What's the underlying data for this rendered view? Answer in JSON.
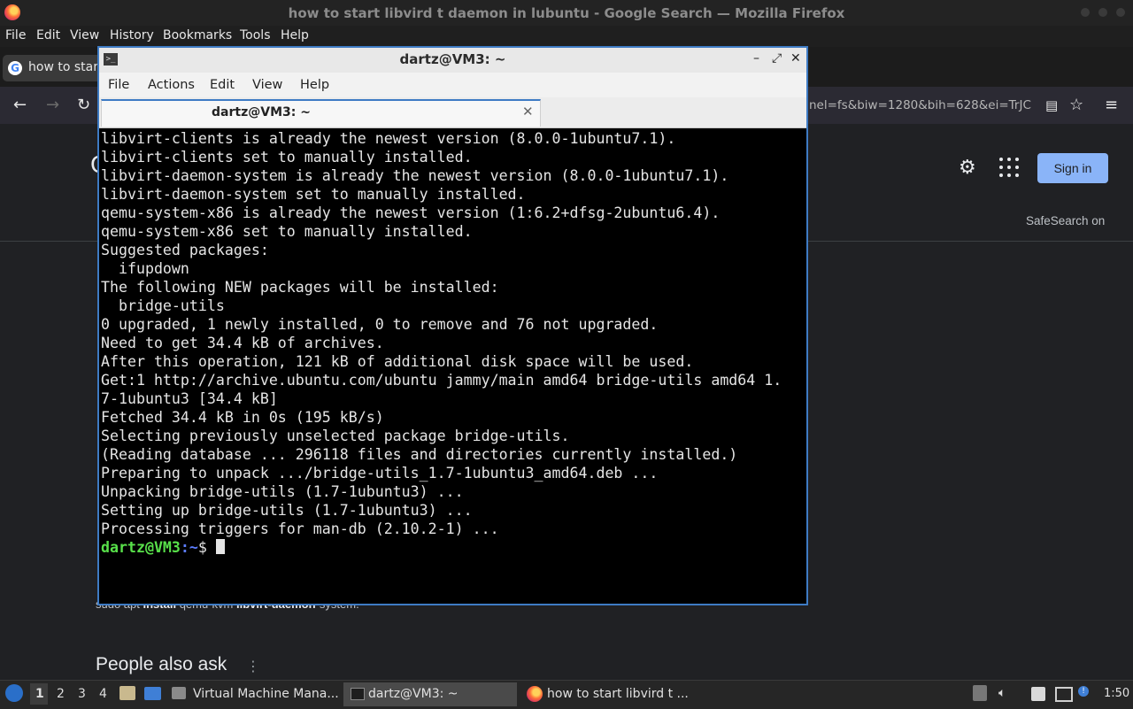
{
  "firefox": {
    "window_title": "how to start libvird t daemon in lubuntu - Google Search — Mozilla Firefox",
    "menu": [
      "File",
      "Edit",
      "View",
      "History",
      "Bookmarks",
      "Tools",
      "Help"
    ],
    "tab_label": "how to start",
    "url_tail": "nel=fs&biw=1280&bih=628&ei=TrJC",
    "google": {
      "signin": "Sign in",
      "safesearch": "SafeSearch on",
      "snippet_prefix": "sudo apt ",
      "snippet_b1": "install",
      "snippet_mid": " qemu-kvm ",
      "snippet_b2": "libvirt-daemon",
      "snippet_suffix": "-system.",
      "people_also_ask": "People also ask"
    }
  },
  "terminal": {
    "window_title": "dartz@VM3: ~",
    "menu": [
      "File",
      "Actions",
      "Edit",
      "View",
      "Help"
    ],
    "tab_label": "dartz@VM3: ~",
    "output_lines": [
      "libvirt-clients is already the newest version (8.0.0-1ubuntu7.1).",
      "libvirt-clients set to manually installed.",
      "libvirt-daemon-system is already the newest version (8.0.0-1ubuntu7.1).",
      "libvirt-daemon-system set to manually installed.",
      "qemu-system-x86 is already the newest version (1:6.2+dfsg-2ubuntu6.4).",
      "qemu-system-x86 set to manually installed.",
      "Suggested packages:",
      "  ifupdown",
      "The following NEW packages will be installed:",
      "  bridge-utils",
      "0 upgraded, 1 newly installed, 0 to remove and 76 not upgraded.",
      "Need to get 34.4 kB of archives.",
      "After this operation, 121 kB of additional disk space will be used.",
      "Get:1 http://archive.ubuntu.com/ubuntu jammy/main amd64 bridge-utils amd64 1.",
      "7-1ubuntu3 [34.4 kB]",
      "Fetched 34.4 kB in 0s (195 kB/s)",
      "Selecting previously unselected package bridge-utils.",
      "(Reading database ... 296118 files and directories currently installed.)",
      "Preparing to unpack .../bridge-utils_1.7-1ubuntu3_amd64.deb ...",
      "Unpacking bridge-utils (1.7-1ubuntu3) ...",
      "Setting up bridge-utils (1.7-1ubuntu3) ...",
      "Processing triggers for man-db (2.10.2-1) ..."
    ],
    "prompt_user": "dartz@VM3",
    "prompt_path": ":~",
    "prompt_symbol": "$ "
  },
  "taskbar": {
    "workspaces": [
      "1",
      "2",
      "3",
      "4"
    ],
    "active_workspace": "1",
    "tasks": [
      {
        "label": "Virtual Machine Mana...",
        "icon": "virt-manager-icon"
      },
      {
        "label": "dartz@VM3: ~",
        "icon": "terminal-icon",
        "active": true
      },
      {
        "label": "how to start libvird t ...",
        "icon": "firefox-icon"
      }
    ],
    "clock": "1:50"
  },
  "colors": {
    "terminal_border": "#3e7bc4",
    "prompt_user": "#58e04a",
    "prompt_path": "#5c7cff",
    "signin_button": "#8ab4f8"
  }
}
